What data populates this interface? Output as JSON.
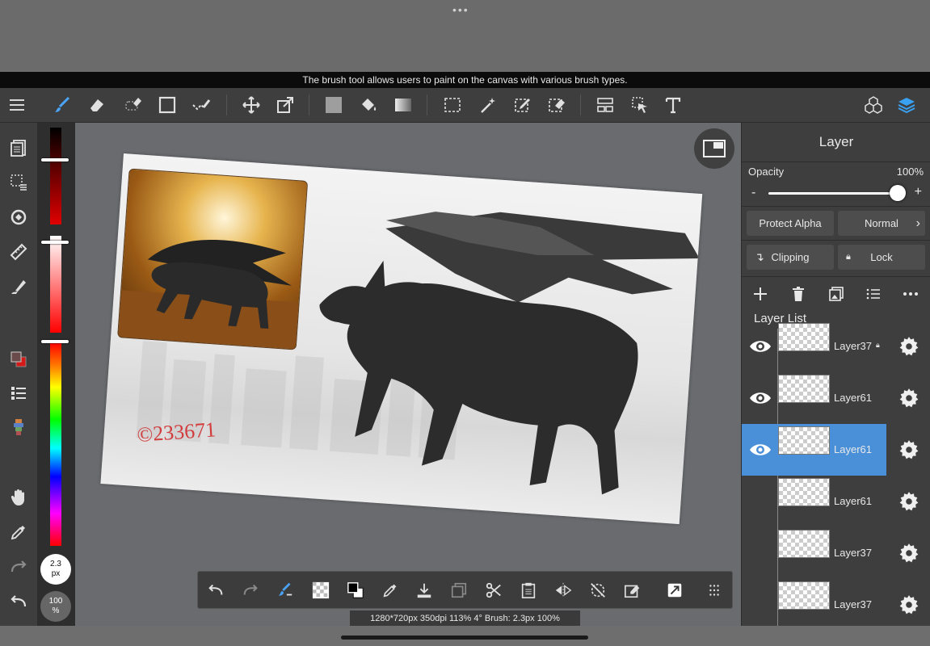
{
  "tooltip": "The brush tool allows users to paint on the canvas with various brush types.",
  "top_icons": [
    "menu-icon",
    "brush-icon",
    "eraser-icon",
    "selection-eraser-icon",
    "rectangle-icon",
    "check-brush-icon",
    "move-icon",
    "transform-icon",
    "fill-color-icon",
    "bucket-icon",
    "gradient-icon",
    "select-rect-icon",
    "magic-wand-icon",
    "select-pen-icon",
    "select-eraser-icon",
    "panel-layout-icon",
    "select-arrow-icon",
    "text-icon",
    "materials-icon",
    "layers-icon"
  ],
  "left_tools": [
    "pages-icon",
    "selection-list-icon",
    "rotate-canvas-icon",
    "ruler-icon",
    "fill-brush-icon",
    "color-swatch-icon",
    "layer-list-icon",
    "palette-icon",
    "hand-icon",
    "eyedropper-icon",
    "redo-icon",
    "undo-icon"
  ],
  "brush_size": {
    "value": "2.3",
    "unit": "px"
  },
  "brush_opacity": {
    "value": "100",
    "unit": "%"
  },
  "color_sliders": {
    "red_level": 1.0,
    "saturation_level": 1.0,
    "hue_level": 0.0
  },
  "canvas": {
    "signature": "©233671"
  },
  "layer_panel": {
    "title": "Layer",
    "opacity_label": "Opacity",
    "opacity_value": "100%",
    "opacity_level": 1.0,
    "minus": "-",
    "plus": "+",
    "protect_alpha": "Protect Alpha",
    "blend_mode": "Normal",
    "clipping": "Clipping",
    "lock": "Lock",
    "list_title": "Layer List",
    "layers": [
      {
        "name": "Layer37",
        "visible": true,
        "locked": true,
        "selected": false
      },
      {
        "name": "Layer61",
        "visible": true,
        "locked": false,
        "selected": false
      },
      {
        "name": "Layer61",
        "visible": true,
        "locked": false,
        "selected": true
      },
      {
        "name": "Layer61",
        "visible": false,
        "locked": false,
        "selected": false
      },
      {
        "name": "Layer37",
        "visible": false,
        "locked": false,
        "selected": false
      },
      {
        "name": "Layer37",
        "visible": false,
        "locked": false,
        "selected": false
      }
    ]
  },
  "bottom_toolbar_icons": [
    "undo-icon",
    "redo-icon",
    "brush-settings-icon",
    "transparent-icon",
    "swap-color-icon",
    "eyedropper-icon",
    "save-icon",
    "copy-icon",
    "cut-icon",
    "paste-icon",
    "flip-icon",
    "rotate-icon",
    "clear-icon",
    "share-icon",
    "grid-icon"
  ],
  "status_text": "1280*720px 350dpi 113% 4° Brush: 2.3px 100%",
  "accent_color": "#4a90d9"
}
